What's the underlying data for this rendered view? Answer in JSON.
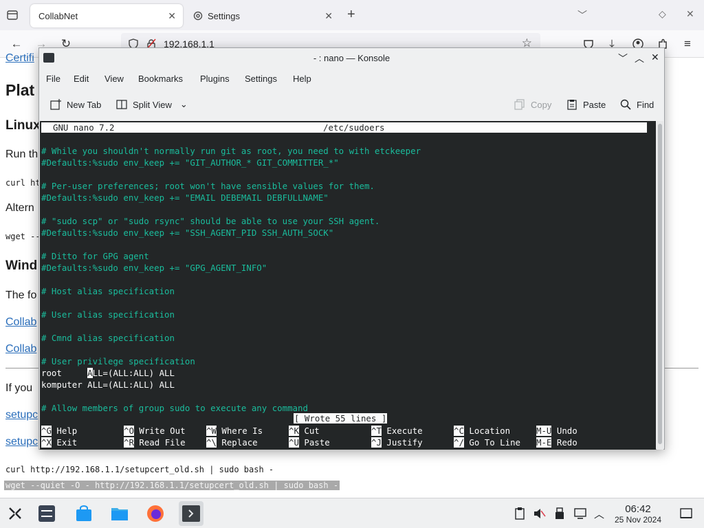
{
  "browser": {
    "tabs": [
      {
        "label": "CollabNet",
        "active": true
      },
      {
        "label": "Settings",
        "active": false
      }
    ],
    "url": "192.168.1.1"
  },
  "page": {
    "link_top": "Certifi",
    "heading_platform": "Plat",
    "heading_linux": "Linux",
    "run_text": "Run th",
    "curl_text": "curl ht",
    "altern_text": "Altern",
    "wget_text": "wget --",
    "heading_windows": "Wind",
    "the_fo": "The fo",
    "collab_link_1": "Collab",
    "collab_link_2": "Collab",
    "if_you": "If you",
    "setup_link_1": "setupc",
    "setup_link_2": "setupc",
    "curl_full": "curl http://192.168.1.1/setupcert_old.sh | sudo bash -",
    "wget_full": "wget --quiet -O - http://192.168.1.1/setupcert_old.sh | sudo bash -"
  },
  "konsole": {
    "title": "- : nano — Konsole",
    "menu": [
      "File",
      "Edit",
      "View",
      "Bookmarks",
      "Plugins",
      "Settings",
      "Help"
    ],
    "toolbar": {
      "new_tab": "New Tab",
      "split_view": "Split View",
      "copy": "Copy",
      "paste": "Paste",
      "find": "Find"
    }
  },
  "nano": {
    "version": "GNU nano 7.2",
    "filename": "/etc/sudoers",
    "lines": [
      {
        "text": "# While you shouldn't normally run git as root, you need to with etckeeper",
        "kind": "comment"
      },
      {
        "text": "#Defaults:%sudo env_keep += \"GIT_AUTHOR_* GIT_COMMITTER_*\"",
        "kind": "comment"
      },
      {
        "text": "",
        "kind": "blank"
      },
      {
        "text": "# Per-user preferences; root won't have sensible values for them.",
        "kind": "comment"
      },
      {
        "text": "#Defaults:%sudo env_keep += \"EMAIL DEBEMAIL DEBFULLNAME\"",
        "kind": "comment"
      },
      {
        "text": "",
        "kind": "blank"
      },
      {
        "text": "# \"sudo scp\" or \"sudo rsync\" should be able to use your SSH agent.",
        "kind": "comment"
      },
      {
        "text": "#Defaults:%sudo env_keep += \"SSH_AGENT_PID SSH_AUTH_SOCK\"",
        "kind": "comment"
      },
      {
        "text": "",
        "kind": "blank"
      },
      {
        "text": "# Ditto for GPG agent",
        "kind": "comment"
      },
      {
        "text": "#Defaults:%sudo env_keep += \"GPG_AGENT_INFO\"",
        "kind": "comment"
      },
      {
        "text": "",
        "kind": "blank"
      },
      {
        "text": "# Host alias specification",
        "kind": "comment"
      },
      {
        "text": "",
        "kind": "blank"
      },
      {
        "text": "# User alias specification",
        "kind": "comment"
      },
      {
        "text": "",
        "kind": "blank"
      },
      {
        "text": "# Cmnd alias specification",
        "kind": "comment"
      },
      {
        "text": "",
        "kind": "blank"
      },
      {
        "text": "# User privilege specification",
        "kind": "comment"
      },
      {
        "text": "root     ",
        "cursor": "A",
        "after": "LL=(ALL:ALL) ALL",
        "kind": "code"
      },
      {
        "text": "komputer ALL=(ALL:ALL) ALL",
        "kind": "code"
      },
      {
        "text": "",
        "kind": "blank"
      },
      {
        "text": "# Allow members of group sudo to execute any command",
        "kind": "comment"
      }
    ],
    "status": "[ Wrote 55 lines ]",
    "shortcuts_row1": [
      {
        "key": "^G",
        "label": "Help"
      },
      {
        "key": "^O",
        "label": "Write Out"
      },
      {
        "key": "^W",
        "label": "Where Is"
      },
      {
        "key": "^K",
        "label": "Cut"
      },
      {
        "key": "^T",
        "label": "Execute"
      },
      {
        "key": "^C",
        "label": "Location"
      },
      {
        "key": "M-U",
        "label": "Undo"
      }
    ],
    "shortcuts_row2": [
      {
        "key": "^X",
        "label": "Exit"
      },
      {
        "key": "^R",
        "label": "Read File"
      },
      {
        "key": "^\\",
        "label": "Replace"
      },
      {
        "key": "^U",
        "label": "Paste"
      },
      {
        "key": "^J",
        "label": "Justify"
      },
      {
        "key": "^/",
        "label": "Go To Line"
      },
      {
        "key": "M-E",
        "label": "Redo"
      }
    ]
  },
  "taskbar": {
    "time": "06:42",
    "date": "25 Nov 2024"
  },
  "colors": {
    "terminal_bg": "#232627",
    "comment": "#1abc9c",
    "link": "#2a6ebb"
  }
}
